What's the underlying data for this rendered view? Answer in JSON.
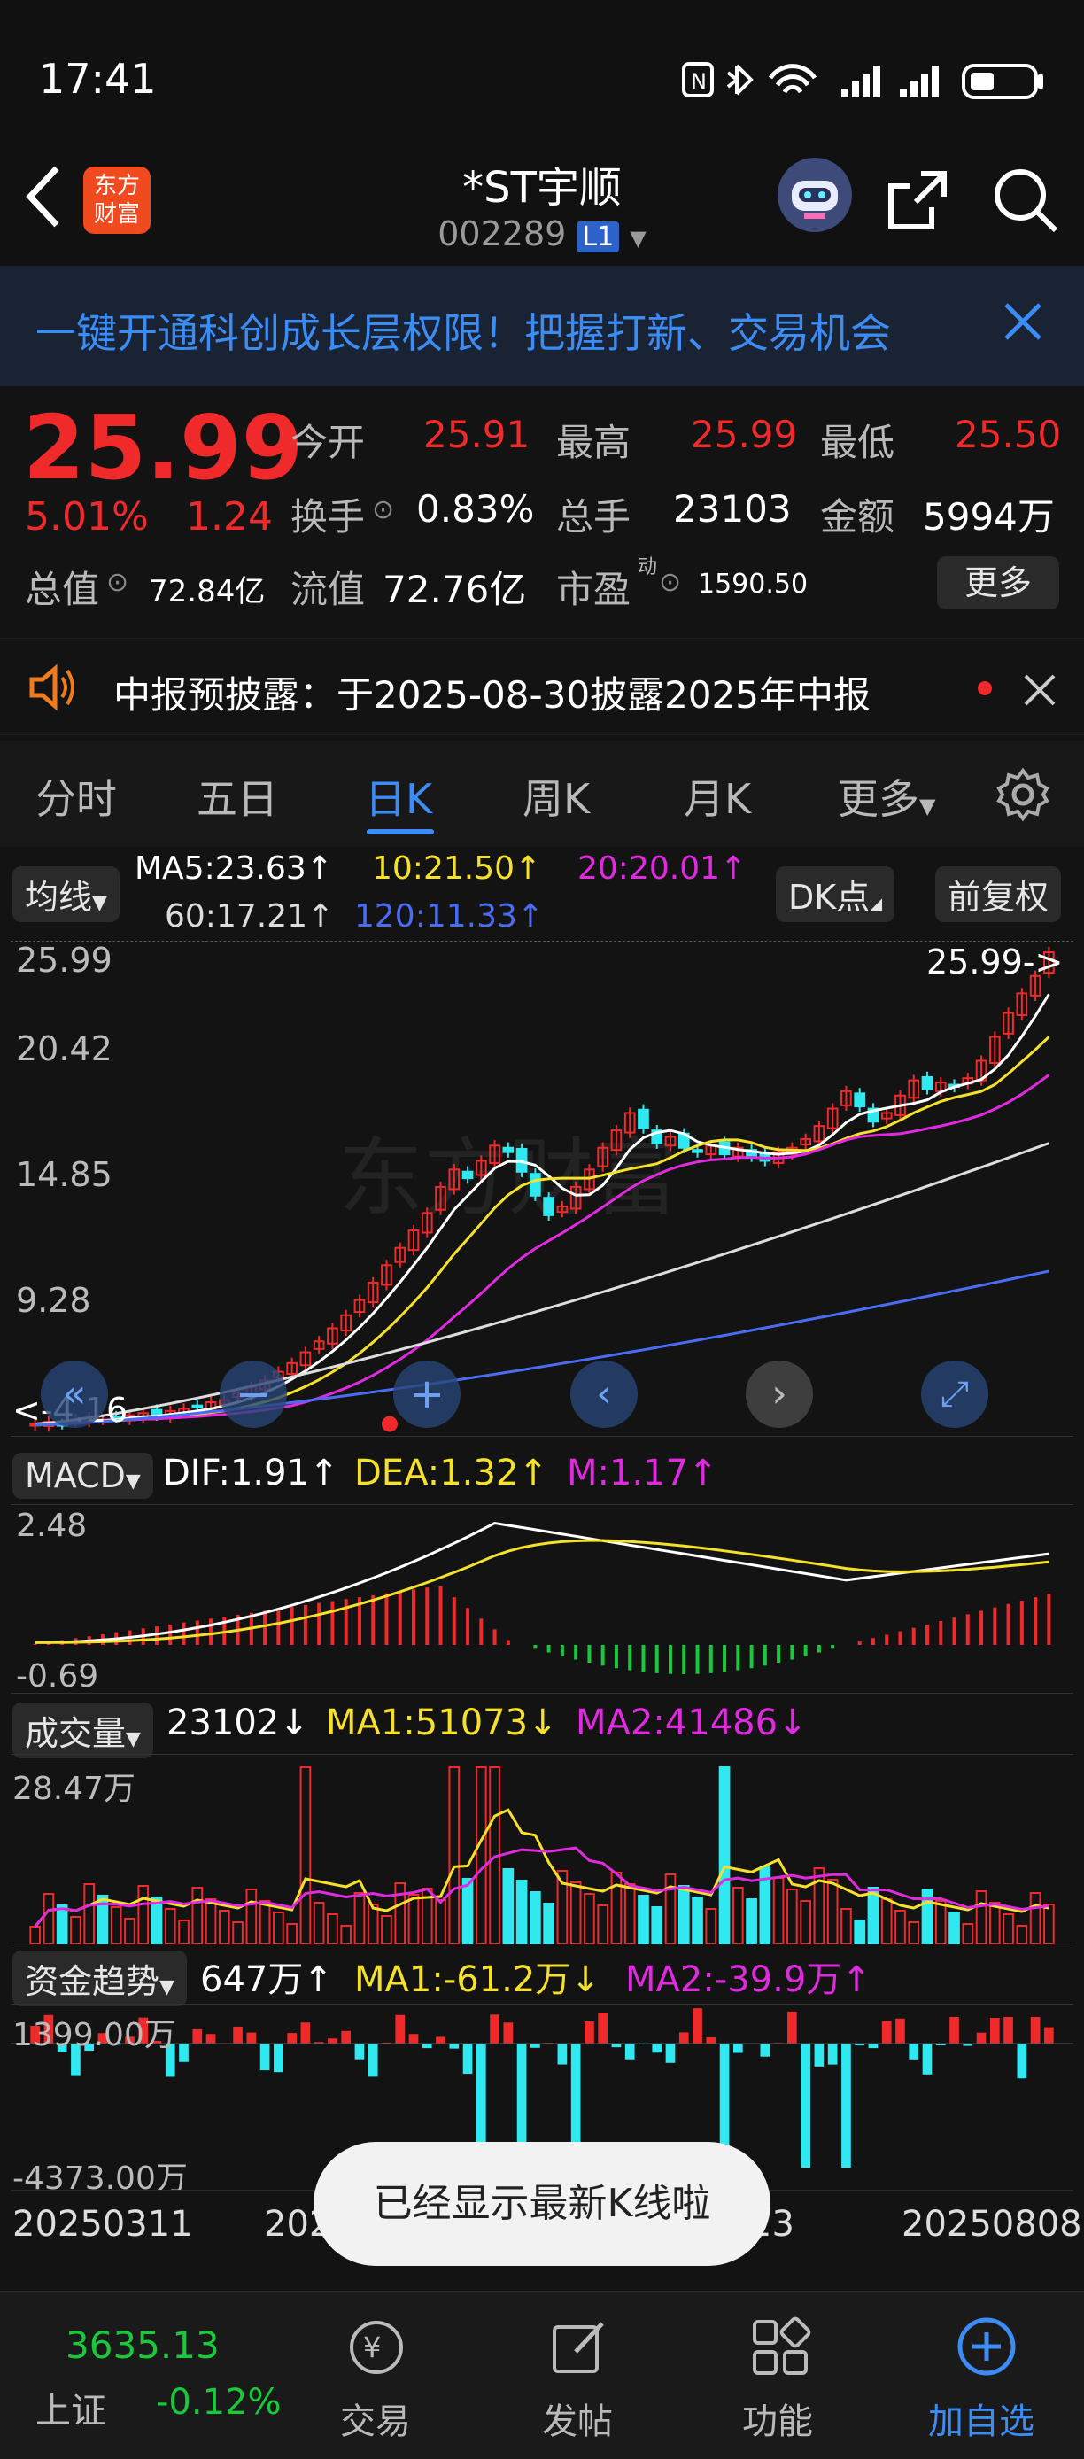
{
  "status": {
    "time": "17:41"
  },
  "header": {
    "back_label": "<",
    "logo_line1": "东方",
    "logo_line2": "财富",
    "title": "*ST宇顺",
    "code": "002289",
    "level": "L1"
  },
  "banner": {
    "text": "一键开通科创成长层权限！把握打新、交易机会"
  },
  "quote": {
    "price": "25.99",
    "pct": "5.01%",
    "change": "1.24",
    "open_label": "今开",
    "open": "25.91",
    "high_label": "最高",
    "high": "25.99",
    "low_label": "最低",
    "low": "25.50",
    "turnover_label": "换手",
    "turnover": "0.83%",
    "volume_label": "总手",
    "volume": "23103",
    "amount_label": "金额",
    "amount": "5994万",
    "mktcap_label": "总值",
    "mktcap": "72.84亿",
    "float_label": "流值",
    "float": "72.76亿",
    "pe_label": "市盈",
    "pe_sup": "动",
    "pe": "1590.50",
    "more": "更多"
  },
  "notice": {
    "text": "中报预披露：于2025-08-30披露2025年中报"
  },
  "tabs": [
    "分时",
    "五日",
    "日K",
    "周K",
    "月K",
    "更多"
  ],
  "kline": {
    "ma_selector": "均线",
    "ma5": "MA5:23.63↑",
    "ma10": "10:21.50↑",
    "ma20": "20:20.01↑",
    "ma60": "60:17.21↑",
    "ma120": "120:11.33↑",
    "dk": "DK点",
    "adjust": "前复权",
    "yticks": [
      "25.99",
      "20.42",
      "14.85",
      "9.28"
    ],
    "last_label": "25.99->",
    "low_label": "<-4.16",
    "watermark": "东方财富"
  },
  "macd": {
    "selector": "MACD",
    "dif": "DIF:1.91↑",
    "dea": "DEA:1.32↑",
    "m": "M:1.17↑",
    "ymax": "2.48",
    "ymin": "-0.69"
  },
  "vol": {
    "selector": "成交量",
    "val": "23102↓",
    "ma1": "MA1:51073↓",
    "ma2": "MA2:41486↓",
    "ymax": "28.47万"
  },
  "fund": {
    "selector": "资金趋势",
    "val": "647万↑",
    "ma1": "MA1:-61.2万↓",
    "ma2": "MA2:-39.9万↑",
    "ymax": "1399.00万",
    "ymin": "-4373.00万"
  },
  "dates": {
    "start": "20250311",
    "mid1": "202",
    "mid2": "23",
    "end": "20250808"
  },
  "toast": "已经显示最新K线啦",
  "bottom": {
    "index_value": "3635.13",
    "index_name": "上证",
    "index_pct": "-0.12%",
    "trade": "交易",
    "post": "发帖",
    "func": "功能",
    "add": "加自选"
  },
  "colors": {
    "up": "#f02a2a",
    "down": "#19c93b",
    "accent": "#3b8cf5",
    "cyan": "#30e8f0"
  },
  "chart_data": {
    "type": "candlestick",
    "ylim": [
      4.16,
      25.99
    ],
    "close": [
      4.3,
      4.4,
      4.3,
      4.5,
      4.6,
      4.5,
      4.6,
      4.7,
      4.8,
      4.7,
      4.9,
      5.0,
      5.1,
      5.3,
      5.4,
      5.7,
      6.0,
      6.3,
      6.7,
      7.1,
      7.6,
      8.1,
      8.7,
      9.3,
      10.0,
      10.8,
      11.6,
      12.4,
      13.2,
      14.0,
      15.2,
      16.0,
      15.6,
      16.4,
      17.1,
      16.8,
      15.9,
      14.8,
      13.9,
      14.3,
      15.2,
      16.0,
      17.0,
      17.8,
      18.6,
      17.9,
      17.2,
      17.5,
      17.0,
      16.8,
      17.1,
      16.7,
      17.0,
      16.6,
      16.4,
      16.8,
      17.0,
      17.4,
      18.0,
      18.8,
      19.6,
      18.9,
      18.2,
      18.6,
      19.4,
      20.1,
      19.7,
      20.0,
      19.8,
      20.2,
      21.0,
      22.1,
      23.2,
      24.1,
      24.9,
      25.99
    ]
  }
}
